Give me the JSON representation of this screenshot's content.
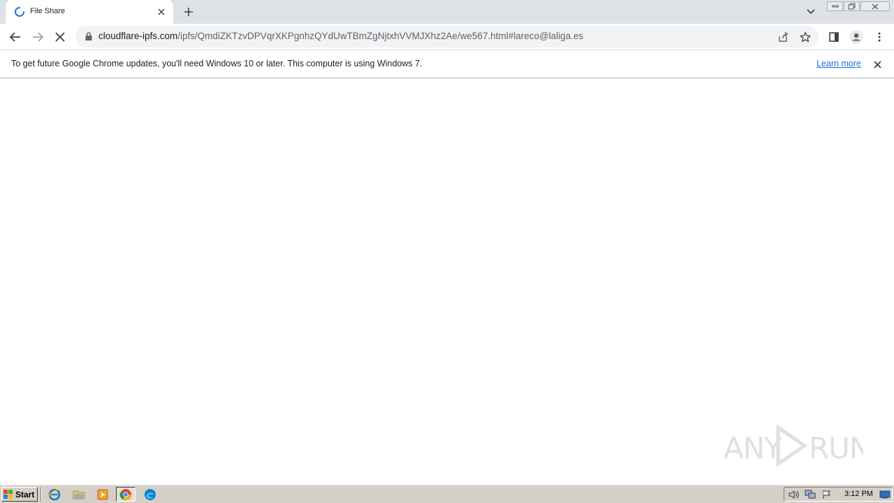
{
  "browser": {
    "tab": {
      "title": "File Share",
      "loading": true
    },
    "window_controls": [
      "minimize",
      "restore",
      "close"
    ]
  },
  "toolbar": {
    "url_host": "cloudflare-ipfs.com",
    "url_path": "/ipfs/QmdiZKTzvDPVqrXKPgnhzQYdUwTBmZgNjtxhVVMJXhz2Ae/we567.html#lareco@laliga.es"
  },
  "infobar": {
    "message": "To get future Google Chrome updates, you'll need Windows 10 or later. This computer is using Windows 7.",
    "link_label": "Learn more"
  },
  "watermark": {
    "text": "ANY RUN"
  },
  "taskbar": {
    "start_label": "Start",
    "clock": "3:12 PM",
    "quick_launch": [
      "internet-explorer-icon",
      "explorer-icon",
      "media-player-icon",
      "chrome-icon",
      "edge-icon"
    ]
  },
  "colors": {
    "tabstrip": "#dee1e6",
    "link": "#1a73e8",
    "taskbar": "#d4d0c8"
  }
}
